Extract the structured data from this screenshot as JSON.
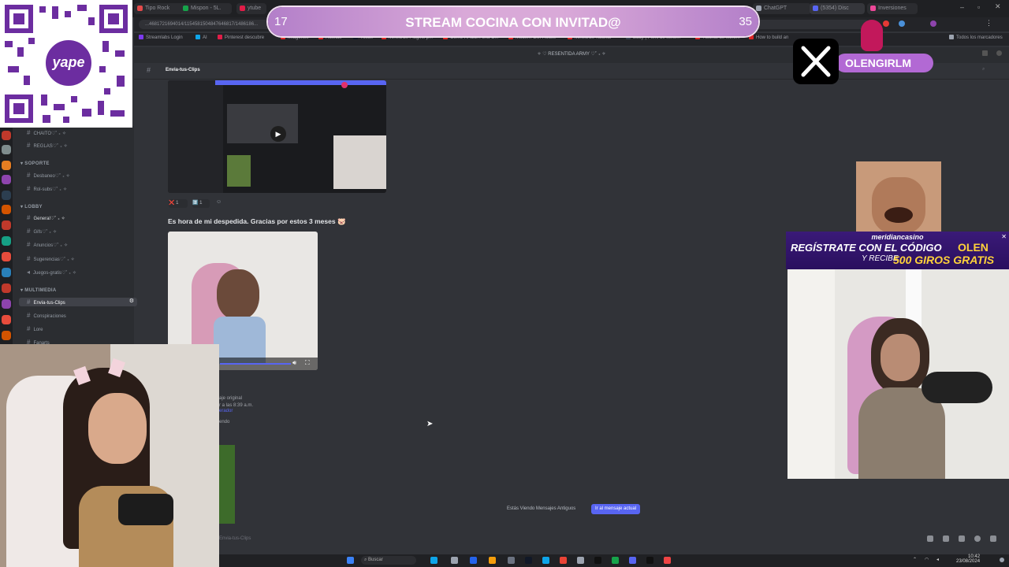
{
  "browser": {
    "tabs": [
      {
        "label": "Tipo Rock",
        "color": "#e34a4a"
      },
      {
        "label": "Mispon - 5L.",
        "color": "#16a34a"
      },
      {
        "label": "ytube",
        "color": "#e11d48"
      },
      {
        "label": "ChatGPT",
        "color": "#9ca3af"
      },
      {
        "label": "(5354) Disc",
        "color": "#5865f2"
      },
      {
        "label": "Inversiones",
        "color": "#ec4899"
      }
    ],
    "url": "...4681721694014/1154581504847646817/1486186..."
  },
  "bookmarks": [
    {
      "label": "Streamlabs Login",
      "color": "#7c3aed"
    },
    {
      "label": "AI",
      "color": "#0ea5e9"
    },
    {
      "label": "Pinterest descubre",
      "color": "#e11d48"
    },
    {
      "label": "Imagenes",
      "color": "#dc2626"
    },
    {
      "label": "Ruletas",
      "color": "#dc2626"
    },
    {
      "label": "Tiktok",
      "color": "#111827"
    },
    {
      "label": "Minecraft Plugins p...",
      "color": "#dc2626"
    },
    {
      "label": "Como HACER una C...",
      "color": "#dc2626"
    },
    {
      "label": "Modern Cliff House",
      "color": "#dc2626"
    },
    {
      "label": "Minecraft Tutorial",
      "color": "#dc2626"
    },
    {
      "label": "Eddy | Perfil de Mine...",
      "color": "#374151"
    },
    {
      "label": "Tutorial de Mine...",
      "color": "#dc2626"
    },
    {
      "label": "How to build an",
      "color": "#dc2626"
    },
    {
      "label": "Todos los marcadores",
      "color": "#9ca3af"
    }
  ],
  "discord": {
    "server_title": "✧ ♡ RESENTIDA ARMY ♡˚ ₊ ✧",
    "channel_header": "Envia-tus-Clips",
    "channels": [
      {
        "type": "channel",
        "label": "CHAITO♡˚ ₊ ✧"
      },
      {
        "type": "channel",
        "label": "REGLAS♡˚ ₊ ✧"
      },
      {
        "type": "category",
        "label": "SOPORTE"
      },
      {
        "type": "channel",
        "label": "Desbaneo♡˚ ₊ ✧"
      },
      {
        "type": "channel",
        "label": "Rol-subs♡˚ ₊ ✧"
      },
      {
        "type": "category",
        "label": "LOBBY"
      },
      {
        "type": "channel",
        "label": "General♡˚ ₊ ✧"
      },
      {
        "type": "channel",
        "label": "Gifs♡˚ ₊ ✧"
      },
      {
        "type": "channel",
        "label": "Anuncios♡˚ ₊ ✧"
      },
      {
        "type": "channel",
        "label": "Sugerencias♡˚ ₊ ✧"
      },
      {
        "type": "channel",
        "label": "Juegos-gratis♡˚ ₊ ✧"
      },
      {
        "type": "category",
        "label": "MULTIMEDIA"
      },
      {
        "type": "channel",
        "label": "Envia-tus-Clips",
        "active": true
      },
      {
        "type": "channel",
        "label": "Conspiraciones"
      },
      {
        "type": "channel",
        "label": "Lore"
      },
      {
        "type": "channel",
        "label": "Fanarts"
      }
    ],
    "reactions": [
      {
        "emoji": "❌",
        "count": "1"
      },
      {
        "emoji": "2️⃣",
        "count": "1"
      }
    ],
    "message_text": "Es hora de mi despedida. Gracias por estos 3 meses 🐷",
    "partial_text": [
      "aje original",
      "r a las 8:39 a.m.",
      "erador",
      "endo"
    ],
    "old_messages_label": "Estás Viendo Mensajes Antiguos",
    "jump_button": "Ir al mensaje actual",
    "bottom_text": "Envia-tus-Clips"
  },
  "overlays": {
    "qr_label": "yape",
    "banner_title": "STREAM COCINA CON INVITAD@",
    "banner_left": "17",
    "banner_right": "35",
    "x_handle": "OLENGIRLM",
    "casino_brand": "meridiancasino",
    "casino_line1": "REGÍSTRATE CON EL CÓDIGO",
    "casino_code": "OLEN",
    "casino_line2": "Y RECIBE",
    "casino_offer": "500 GIROS GRATIS"
  },
  "taskbar": {
    "search_label": "Buscar",
    "time": "10:42",
    "date": "23/08/2024"
  }
}
